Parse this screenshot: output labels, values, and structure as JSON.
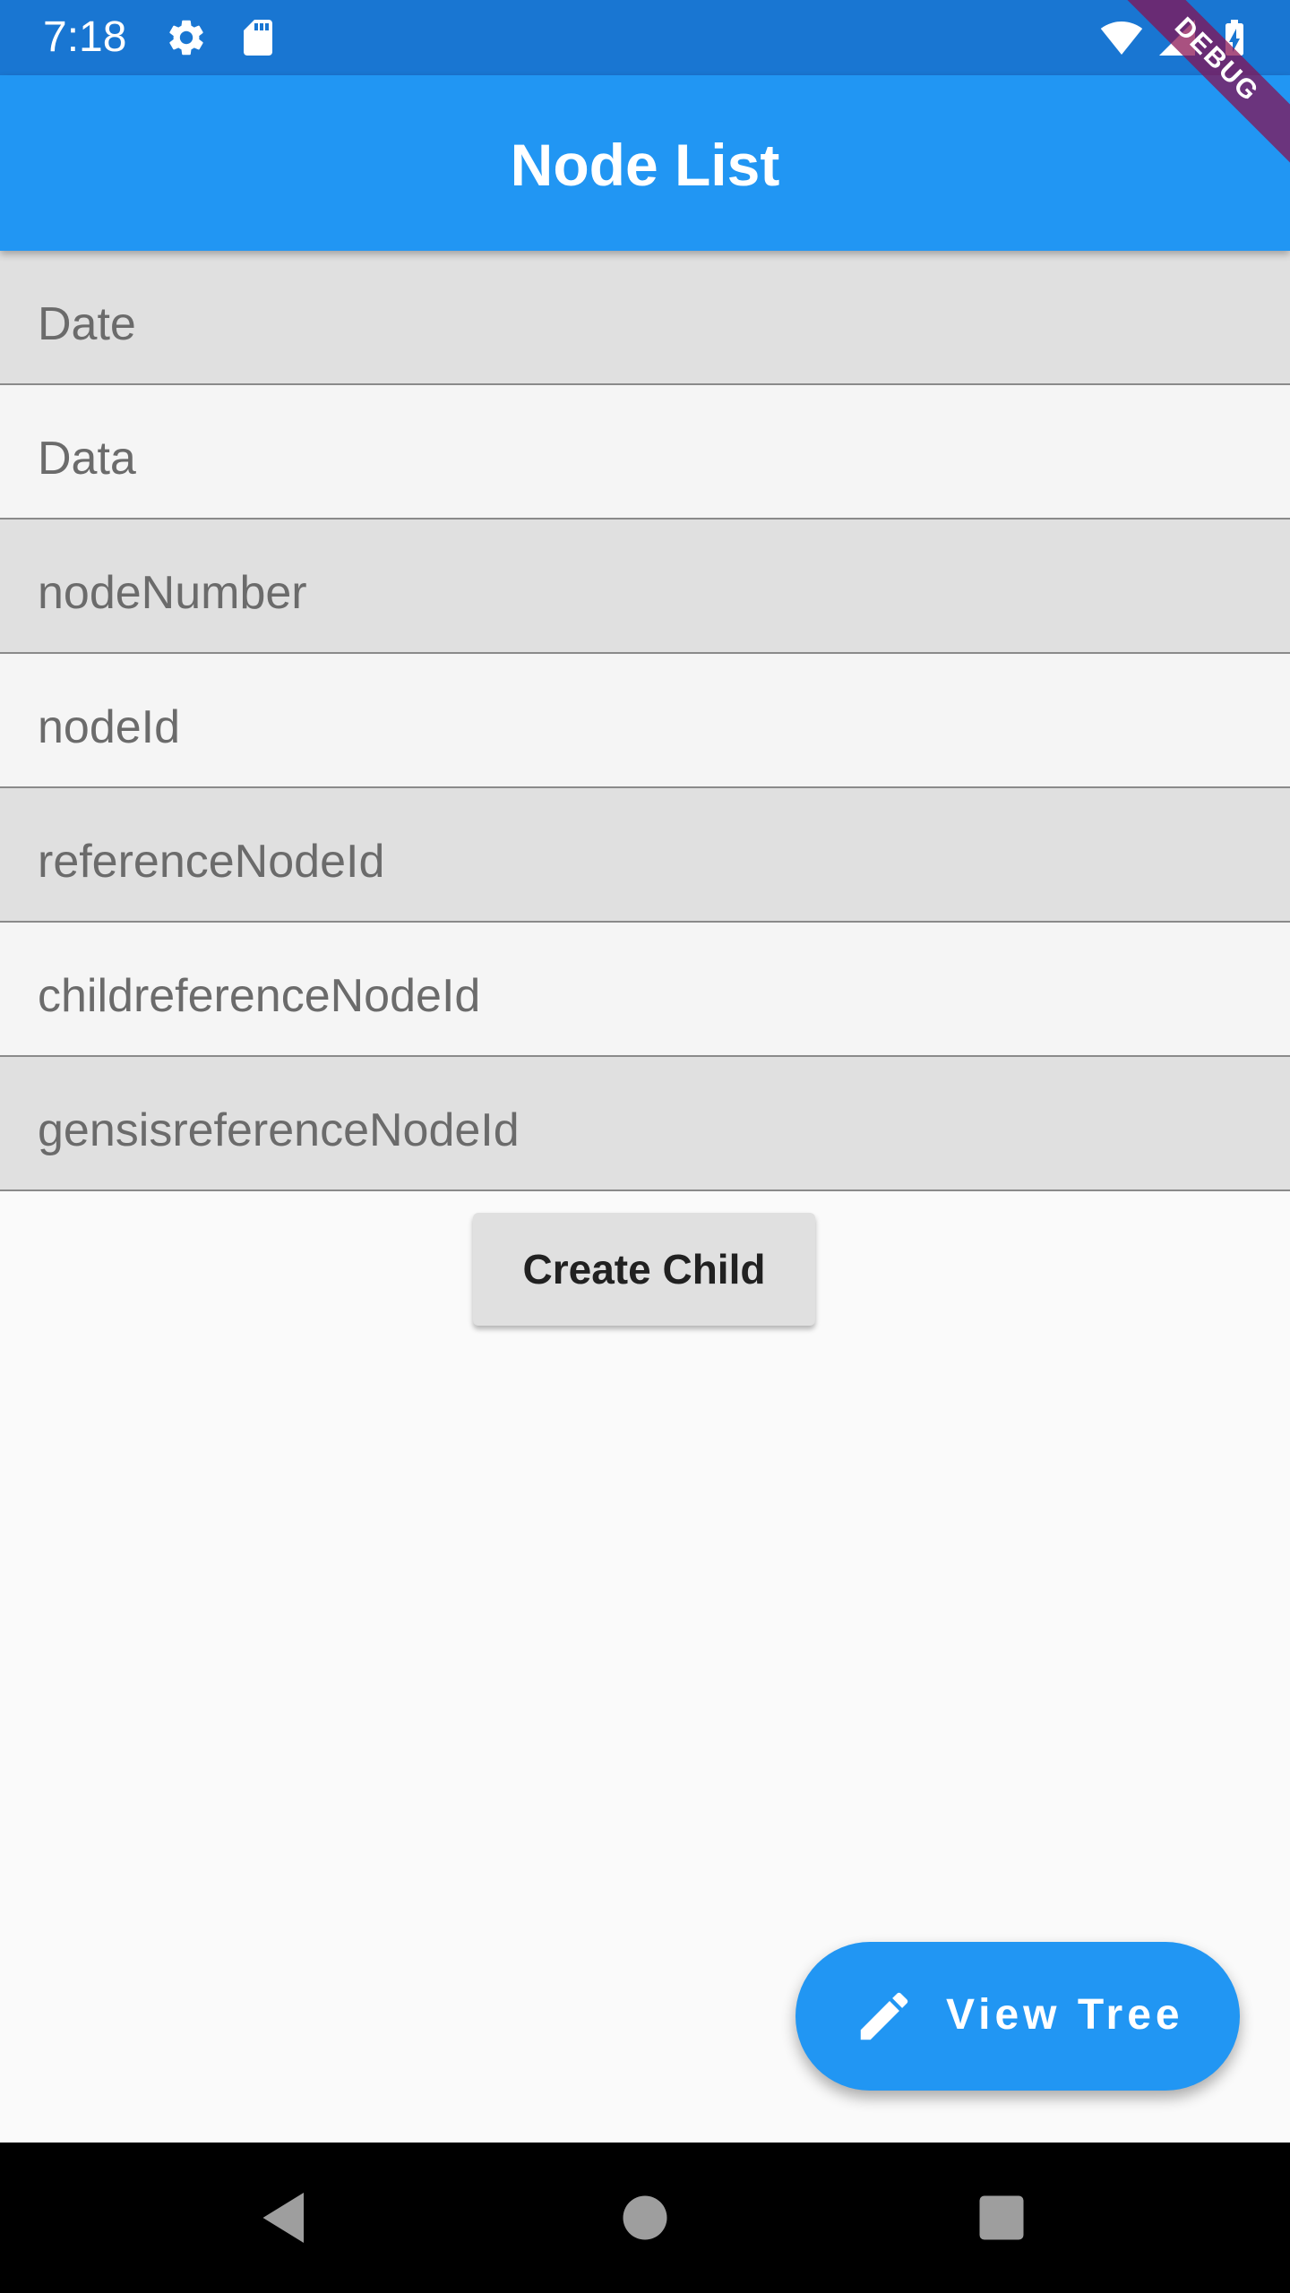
{
  "status_bar": {
    "time": "7:18",
    "icons": [
      "gear-icon",
      "sd-card-icon",
      "wifi-icon",
      "signal-icon",
      "battery-charging-icon"
    ]
  },
  "app_bar": {
    "title": "Node List",
    "debug_banner": "DEBUG"
  },
  "fields": [
    {
      "label": "Date"
    },
    {
      "label": "Data"
    },
    {
      "label": "nodeNumber"
    },
    {
      "label": "nodeId"
    },
    {
      "label": "referenceNodeId"
    },
    {
      "label": "childreferenceNodeId"
    },
    {
      "label": "gensisreferenceNodeId"
    }
  ],
  "actions": {
    "create_child_label": "Create Child",
    "fab_label": "View Tree",
    "fab_icon": "pencil-icon"
  },
  "nav_bar": {
    "icons": [
      "back-icon",
      "home-icon",
      "recents-icon"
    ]
  },
  "colors": {
    "primary": "#2196f3",
    "status_bar": "#1976d2",
    "row_shade_a": "#e0e0e0",
    "row_shade_b": "#f5f5f5",
    "debug_banner": "#880e4f"
  }
}
